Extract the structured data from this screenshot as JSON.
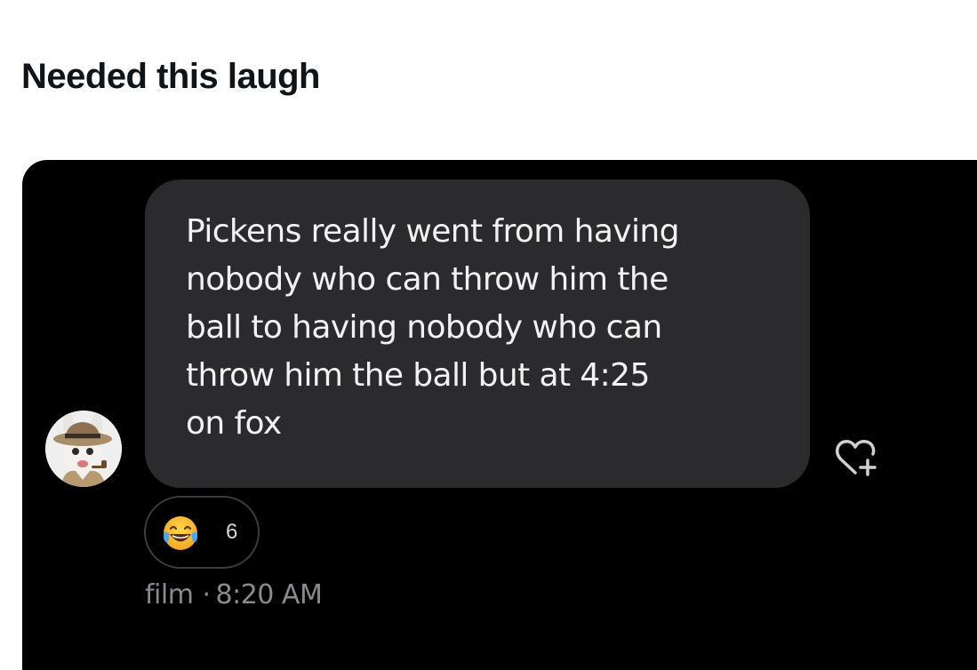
{
  "post": {
    "title": "Needed this laugh"
  },
  "message": {
    "text": "Pickens really went from having\nnobody who can throw him the\nball to having nobody who can\nthrow him the ball but at 4:25\non fox",
    "sender": "film",
    "separator": "·",
    "time": "8:20 AM",
    "reaction": {
      "emoji": "laughing-with-tears-emoji",
      "count": "6"
    },
    "avatar": "rabbid-detective-avatar"
  },
  "icons": {
    "react": "heart-plus-icon"
  },
  "colors": {
    "background": "#000000",
    "bubble": "#2b2b2d",
    "bubble_text": "#f2f2f2",
    "meta_text": "#8a8a8e",
    "title_text": "#0f1419"
  }
}
